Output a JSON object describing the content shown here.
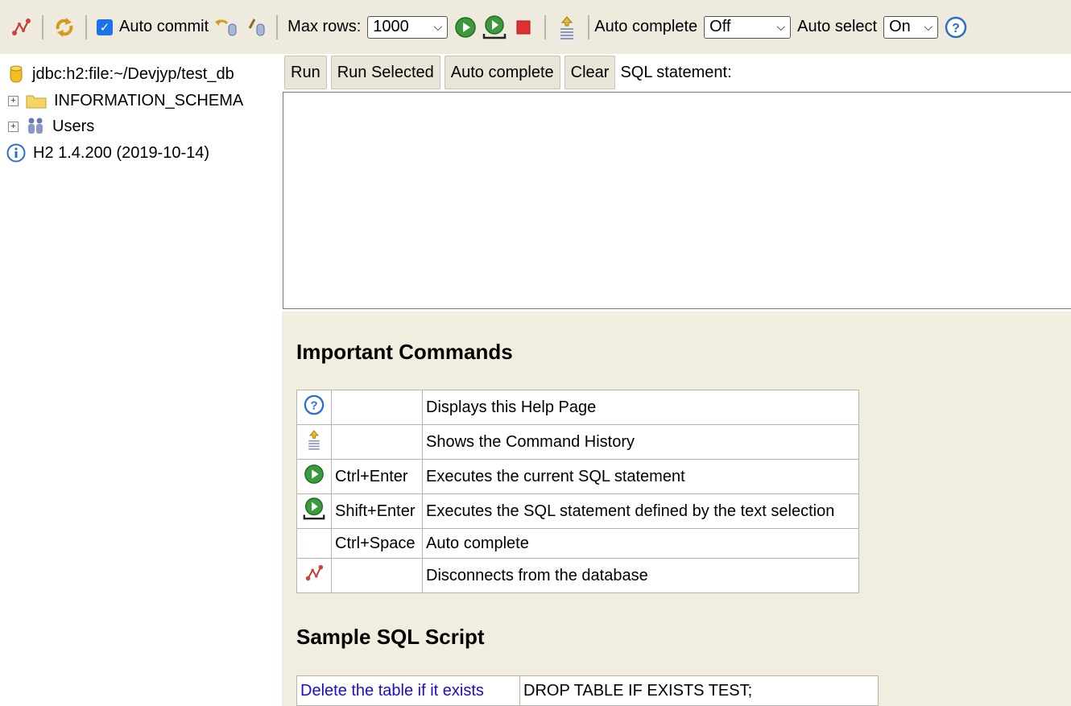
{
  "toolbar": {
    "auto_commit_label": "Auto commit",
    "max_rows_label": "Max rows:",
    "max_rows_value": "1000",
    "auto_complete_label": "Auto complete",
    "auto_complete_value": "Off",
    "auto_select_label": "Auto select",
    "auto_select_value": "On"
  },
  "tree": {
    "connection": "jdbc:h2:file:~/Devjyp/test_db",
    "information_schema": "INFORMATION_SCHEMA",
    "users": "Users",
    "version": "H2 1.4.200 (2019-10-14)"
  },
  "sql": {
    "run": "Run",
    "run_selected": "Run Selected",
    "auto_complete": "Auto complete",
    "clear": "Clear",
    "statement_label": "SQL statement:"
  },
  "help": {
    "important_title": "Important Commands",
    "commands": [
      {
        "icon": "help-icon",
        "key": "",
        "desc": "Displays this Help Page"
      },
      {
        "icon": "history-icon",
        "key": "",
        "desc": "Shows the Command History"
      },
      {
        "icon": "run-icon",
        "key": "Ctrl+Enter",
        "desc": "Executes the current SQL statement"
      },
      {
        "icon": "run-selected-icon",
        "key": "Shift+Enter",
        "desc": "Executes the SQL statement defined by the text selection"
      },
      {
        "icon": "",
        "key": "Ctrl+Space",
        "desc": "Auto complete"
      },
      {
        "icon": "disconnect-icon",
        "key": "",
        "desc": "Disconnects from the database"
      }
    ],
    "sample_title": "Sample SQL Script",
    "sample": [
      {
        "label": "Delete the table if it exists",
        "sql": "DROP TABLE IF EXISTS TEST;"
      }
    ]
  }
}
